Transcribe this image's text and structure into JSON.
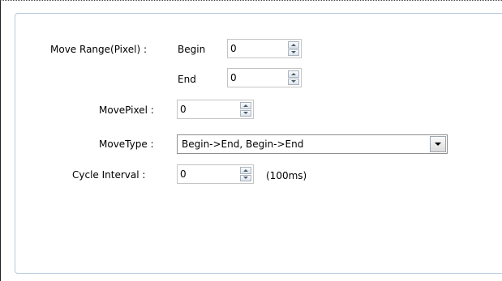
{
  "form": {
    "move_range_label": "Move Range(Pixel) :",
    "begin_label": "Begin",
    "begin_value": "0",
    "end_label": "End",
    "end_value": "0",
    "move_pixel_label": "MovePixel :",
    "move_pixel_value": "0",
    "move_type_label": "MoveType :",
    "move_type_value": "Begin->End, Begin->End",
    "cycle_interval_label": "Cycle Interval :",
    "cycle_interval_value": "0",
    "cycle_interval_unit": "(100ms)"
  },
  "icons": {
    "spin_up": "triangle-up-icon",
    "spin_down": "triangle-down-icon",
    "dropdown": "chevron-down-icon"
  }
}
